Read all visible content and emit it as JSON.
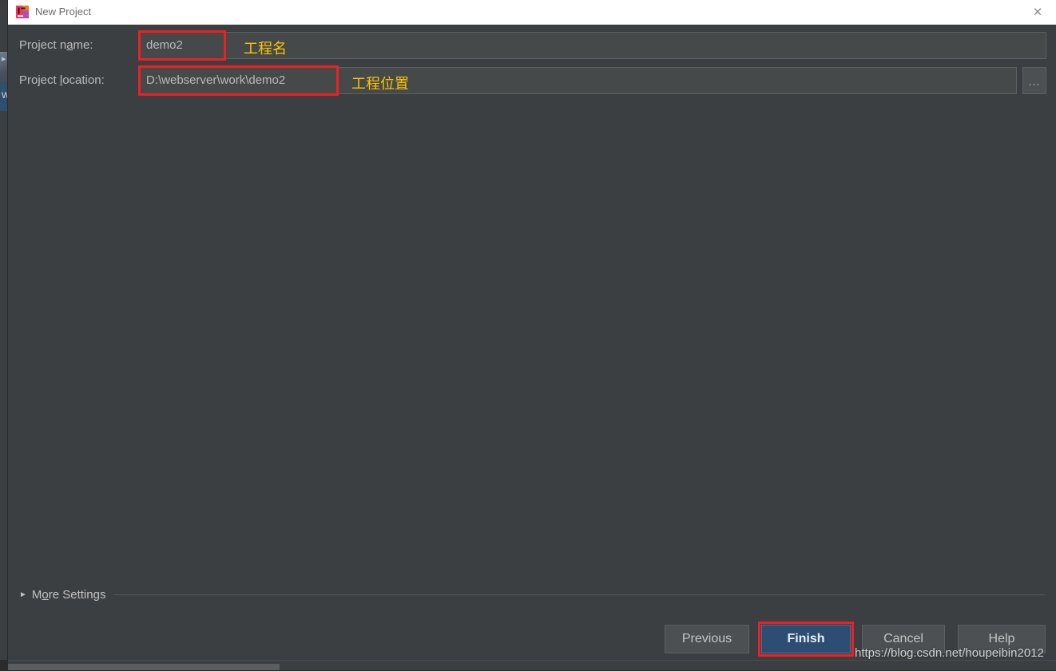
{
  "window": {
    "title": "New Project",
    "app_icon": "intellij-idea-icon",
    "close_icon": "close-icon"
  },
  "form": {
    "name_row": {
      "label_prefix": "Project n",
      "label_mnemonic": "a",
      "label_suffix": "me:",
      "value": "demo2",
      "annotation": "工程名"
    },
    "location_row": {
      "label_prefix": "Project ",
      "label_mnemonic": "l",
      "label_suffix": "ocation:",
      "value": "D:\\webserver\\work\\demo2",
      "annotation": "工程位置",
      "browse_label": "..."
    }
  },
  "more_settings": {
    "arrow_icon": "triangle-right-icon",
    "label_prefix": "M",
    "label_mnemonic": "o",
    "label_suffix": "re Settings"
  },
  "buttons": {
    "previous": "Previous",
    "finish": "Finish",
    "cancel": "Cancel",
    "help": "Help"
  },
  "watermark": "https://blog.csdn.net/houpeibin2012",
  "colors": {
    "dialog_bg": "#3c3f41",
    "field_bg": "#45494a",
    "text": "#bbbbbb",
    "annotation_border": "#ed2024",
    "annotation_text": "#fdc500",
    "finish_bg": "#2e4d73",
    "titlebar_bg": "#ffffff"
  }
}
